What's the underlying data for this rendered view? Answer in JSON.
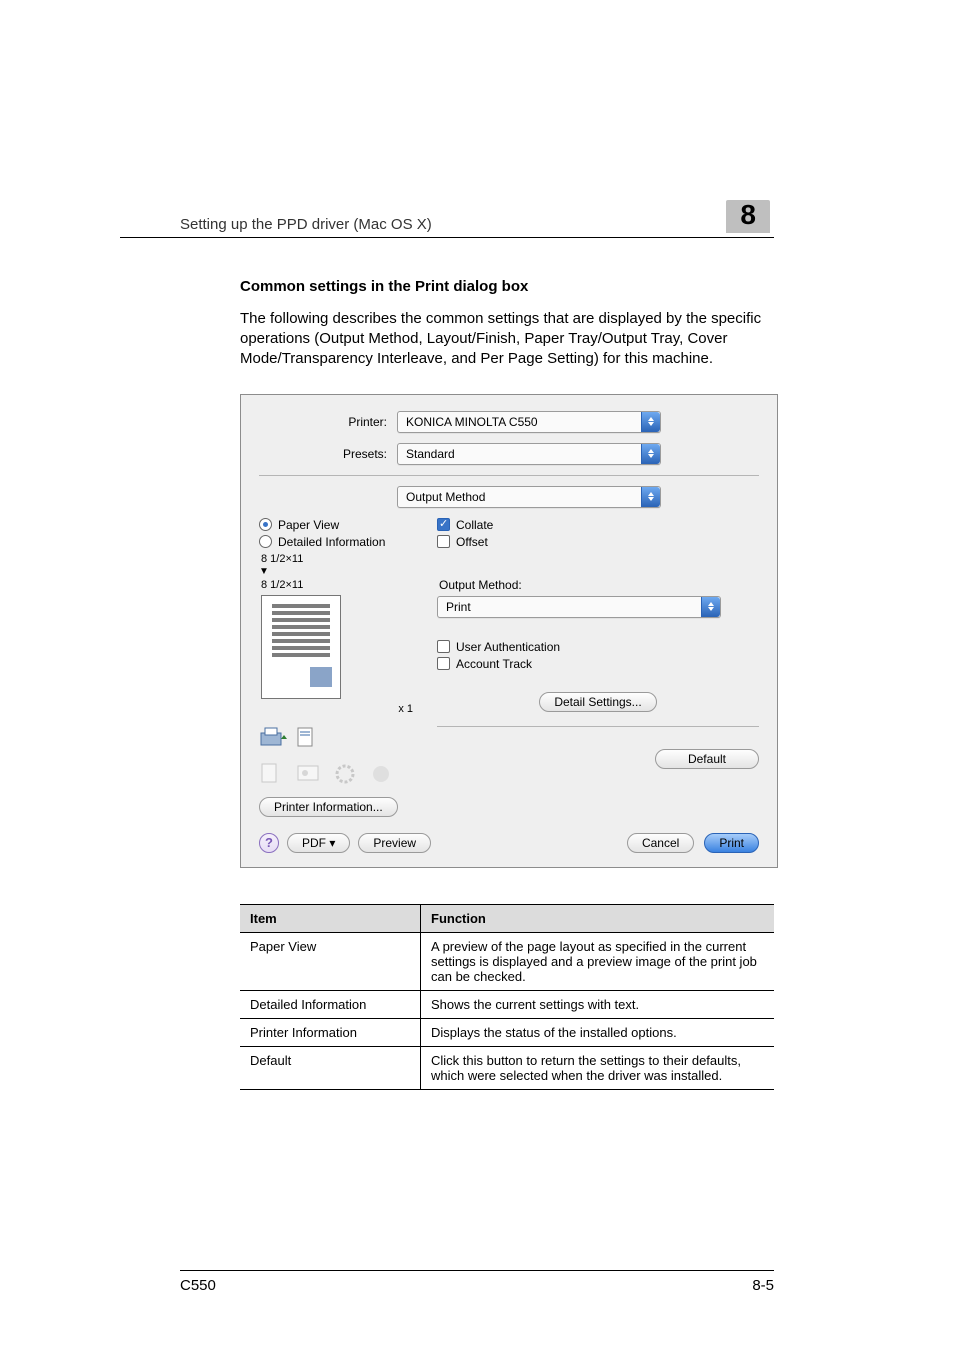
{
  "header": {
    "left": "Setting up the PPD driver (Mac OS X)",
    "right": "8"
  },
  "section_title": "Common settings in the Print dialog box",
  "intro": "The following describes the common settings that are displayed by the specific operations (Output Method, Layout/Finish, Paper Tray/Output Tray, Cover Mode/Transparency Interleave, and Per Page Setting) for this machine.",
  "dialog": {
    "printer_label": "Printer:",
    "printer_value": "KONICA MINOLTA C550",
    "presets_label": "Presets:",
    "presets_value": "Standard",
    "pane_value": "Output Method",
    "radios": {
      "paper_view": "Paper View",
      "detailed_info": "Detailed Information"
    },
    "sizes": {
      "from": "8 1/2×11",
      "to": "8 1/2×11"
    },
    "copies": "x 1",
    "checkboxes": {
      "collate": "Collate",
      "offset": "Offset",
      "user_auth": "User Authentication",
      "account_track": "Account Track"
    },
    "output_method_label": "Output Method:",
    "output_method_value": "Print",
    "buttons": {
      "printer_info": "Printer Information...",
      "detail_settings": "Detail Settings...",
      "default": "Default",
      "pdf": "PDF ▾",
      "preview": "Preview",
      "cancel": "Cancel",
      "print": "Print"
    },
    "help": "?"
  },
  "table": {
    "head_item": "Item",
    "head_func": "Function",
    "rows": [
      {
        "item": "Paper View",
        "func": "A preview of the page layout as specified in the current settings is displayed and a preview image of the print job can be checked."
      },
      {
        "item": "Detailed Information",
        "func": "Shows the current settings with text."
      },
      {
        "item": "Printer Information",
        "func": "Displays the status of the installed options."
      },
      {
        "item": "Default",
        "func": "Click this button to return the settings to their defaults, which were selected when the driver was installed."
      }
    ]
  },
  "footer": {
    "left": "C550",
    "right": "8-5"
  },
  "chart_data": null
}
